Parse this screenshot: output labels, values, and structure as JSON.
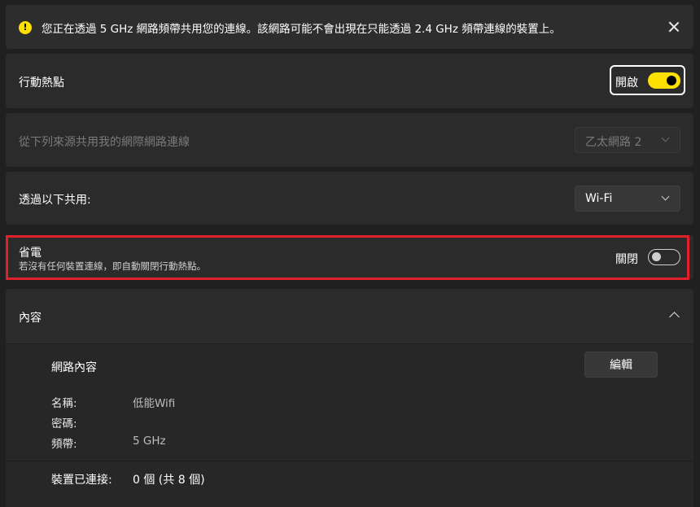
{
  "infobar": {
    "message": "您正在透過 5 GHz 網路頻帶共用您的連線。該網路可能不會出現在只能透過 2.4 GHz 頻帶連線的裝置上。",
    "icon": "warning-icon",
    "accent": "#fce100"
  },
  "hotspot": {
    "label": "行動熱點",
    "state_label": "開啟",
    "is_on": true
  },
  "share_from": {
    "label": "從下列來源共用我的網際網路連線",
    "selected": "乙太網路 2",
    "disabled": true
  },
  "share_over": {
    "label": "透過以下共用:",
    "selected": "Wi-Fi"
  },
  "power_saving": {
    "title": "省電",
    "description": "若沒有任何裝置連線，即自動關閉行動熱點。",
    "state_label": "關閉",
    "is_on": false,
    "highlight_color": "#e0202a"
  },
  "properties": {
    "header": "內容",
    "section_title": "網路內容",
    "edit_label": "編輯",
    "fields": [
      {
        "key": "名稱:",
        "value": "低能Wifi"
      },
      {
        "key": "密碼:",
        "value": ""
      },
      {
        "key": "頻帶:",
        "value": "5 GHz"
      }
    ],
    "devices_key": "裝置已連接:",
    "devices_value": "0 個 (共 8 個)"
  }
}
